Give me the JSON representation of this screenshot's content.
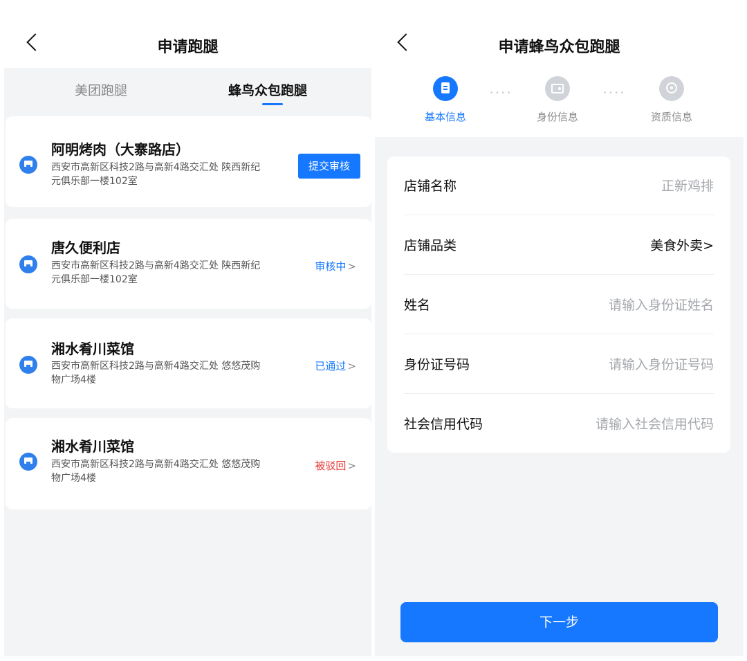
{
  "left": {
    "title": "申请跑腿",
    "tabs": [
      {
        "label": "美团跑腿"
      },
      {
        "label": "蜂鸟众包跑腿"
      }
    ],
    "stores": [
      {
        "name": "阿明烤肉（大寨路店）",
        "address_line1": "西安市高新区科技2路与高新4路交汇处 陕西新纪",
        "address_line2": "元俱乐部一楼102室",
        "action": "提交审核"
      },
      {
        "name": "唐久便利店",
        "address_line1": "西安市高新区科技2路与高新4路交汇处 陕西新纪",
        "address_line2": "元俱乐部一楼102室",
        "status": "审核中",
        "chevron": ">"
      },
      {
        "name": "湘水肴川菜馆",
        "address_line1": "西安市高新区科技2路与高新4路交汇处 悠悠茂购",
        "address_line2": "物广场4楼",
        "status": "已通过",
        "chevron": ">"
      },
      {
        "name": "湘水肴川菜馆",
        "address_line1": "西安市高新区科技2路与高新4路交汇处 悠悠茂购",
        "address_line2": "物广场4楼",
        "status": "被驳回",
        "chevron": ">"
      }
    ]
  },
  "right": {
    "title": "申请蜂鸟众包跑腿",
    "steps": [
      {
        "label": "基本信息",
        "icon": "document-icon"
      },
      {
        "label": "身份信息",
        "icon": "id-card-icon"
      },
      {
        "label": "资质信息",
        "icon": "certificate-icon"
      }
    ],
    "dots": "••••",
    "form": {
      "store_name": {
        "label": "店铺名称",
        "value": "正新鸡排"
      },
      "store_category": {
        "label": "店铺品类",
        "value": "美食外卖>"
      },
      "name": {
        "label": "姓名",
        "placeholder": "请输入身份证姓名"
      },
      "id_number": {
        "label": "身份证号码",
        "placeholder": "请输入身份证号码"
      },
      "credit_code": {
        "label": "社会信用代码",
        "placeholder": "请输入社会信用代码"
      }
    },
    "next_button": "下一步"
  },
  "colors": {
    "primary": "#1677ff",
    "reject": "#e53935",
    "background": "#f3f4f6"
  }
}
